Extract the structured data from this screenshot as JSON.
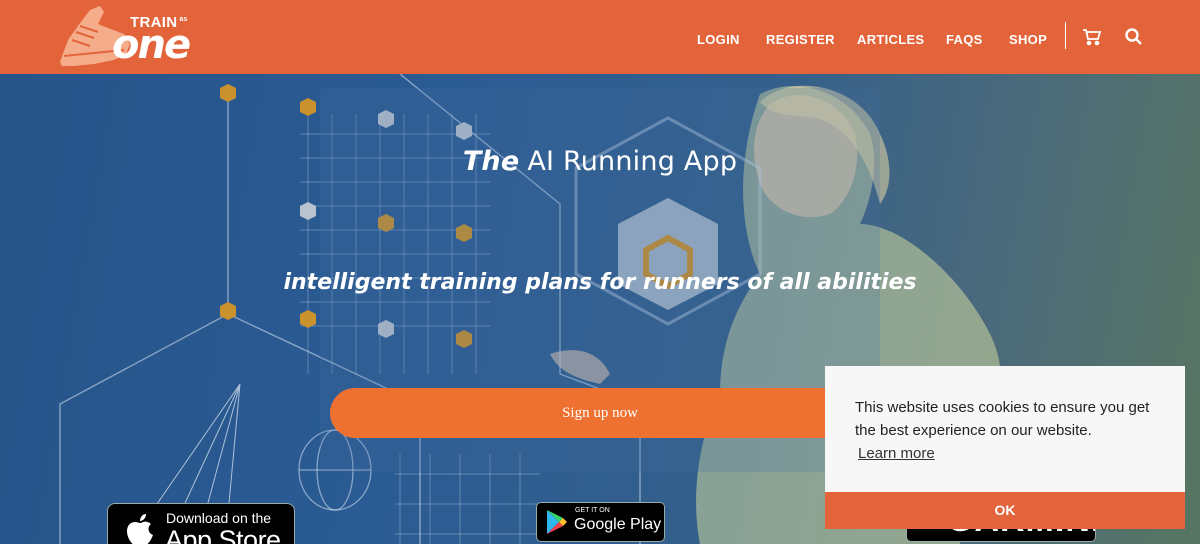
{
  "brand": {
    "logo_top": "TRAIN",
    "logo_as": "as",
    "logo_main": "one",
    "color": "#e3643a"
  },
  "nav": {
    "login": "LOGIN",
    "register": "REGISTER",
    "articles": "ARTICLES",
    "faqs": "FAQS",
    "shop": "SHOP"
  },
  "header_icons": [
    "cart-icon",
    "search-icon"
  ],
  "hero": {
    "title_emphasis": "The",
    "title_rest": "AI Running App",
    "subtitle": "intelligent training plans for runners of all abilities",
    "cta": "Sign up now",
    "cta_color": "#ef7131"
  },
  "badges": {
    "appstore_line1": "Download on the",
    "appstore_line2": "App Store",
    "gplay_line1": "GET IT ON",
    "gplay_line2": "Google Play",
    "garmin": "GARMIN."
  },
  "cookie": {
    "message": "This website uses cookies to ensure you get the best experience on our website.",
    "learn_more": "Learn more",
    "ok": "OK"
  }
}
